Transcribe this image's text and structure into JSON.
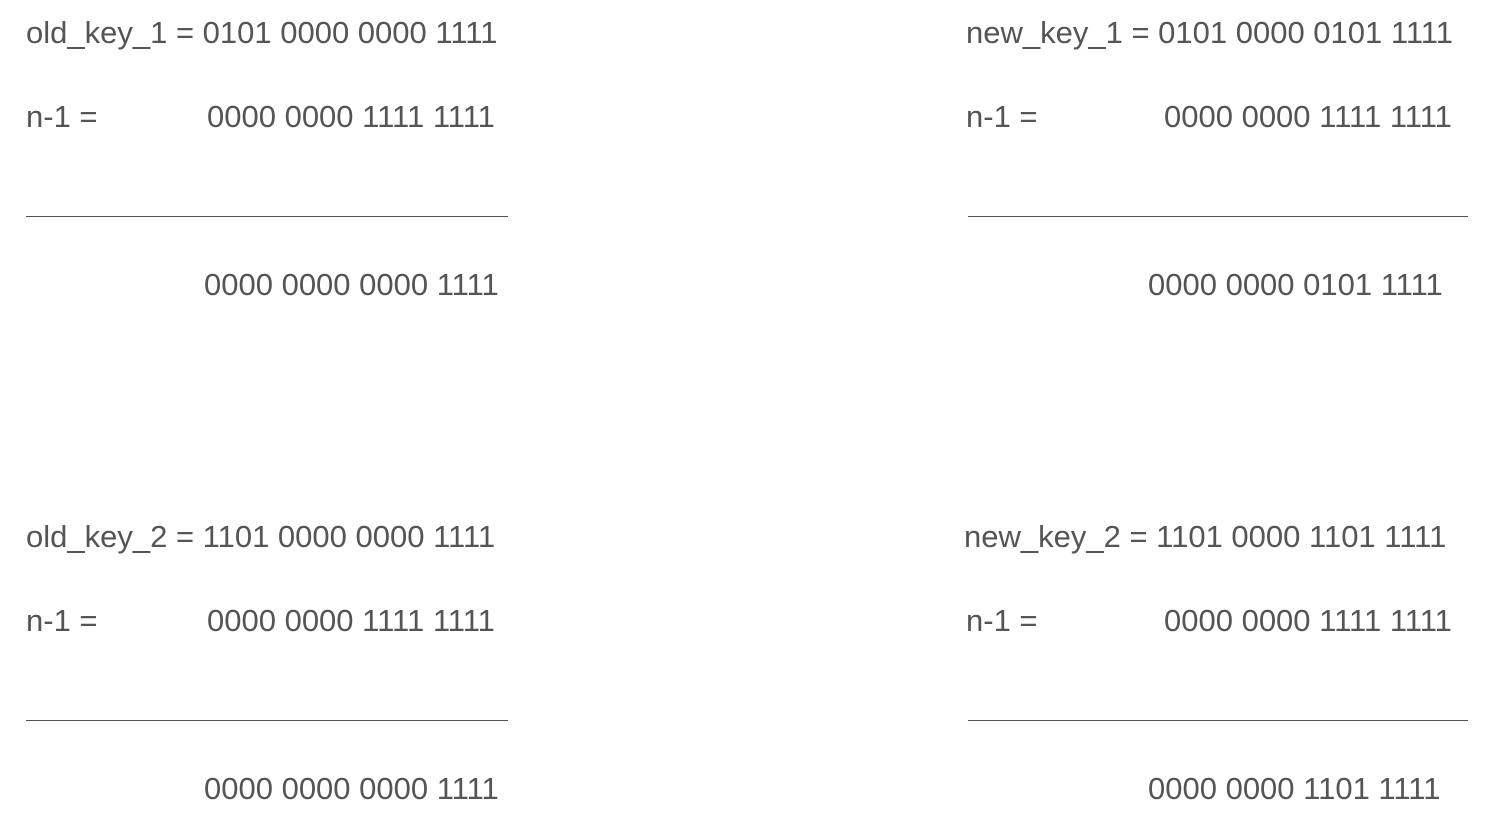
{
  "colors": {
    "background": "#ffffff",
    "text": "#555555"
  },
  "blocks": [
    {
      "line1": "old_key_1 = 0101 0000 0000 1111",
      "mask_label": "n-1 =",
      "mask_bits": "0000 0000 1111 1111",
      "result_bits": "0000 0000 0000 1111"
    },
    {
      "line1": "new_key_1 = 0101 0000 0101 1111",
      "mask_label": "n-1 =",
      "mask_bits": "0000 0000 1111 1111",
      "result_bits": "0000 0000 0101 1111"
    },
    {
      "line1": "old_key_2 = 1101 0000 0000 1111",
      "mask_label": "n-1 =",
      "mask_bits": "0000 0000 1111 1111",
      "result_bits": "0000 0000 0000 1111"
    },
    {
      "line1": "new_key_2 = 1101 0000 1101 1111",
      "mask_label": "n-1 =",
      "mask_bits": "0000 0000 1111 1111",
      "result_bits": "0000 0000 1101 1111"
    }
  ]
}
